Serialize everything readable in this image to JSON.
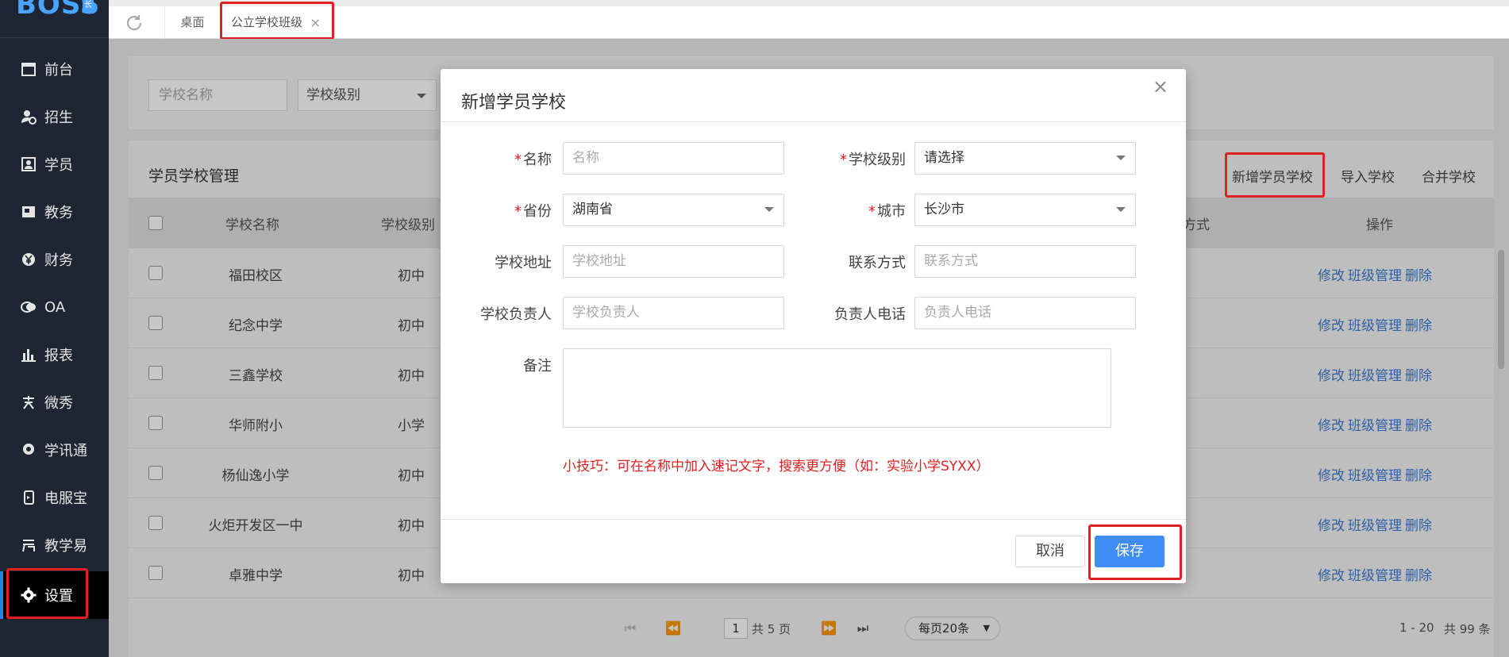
{
  "app": {
    "logo_text": "BOSS",
    "logo_badge": "长"
  },
  "sidebar": {
    "items": [
      {
        "label": "前台",
        "icon": "calendar-icon"
      },
      {
        "label": "招生",
        "icon": "user-add-icon"
      },
      {
        "label": "学员",
        "icon": "person-card-icon"
      },
      {
        "label": "教务",
        "icon": "book-icon"
      },
      {
        "label": "财务",
        "icon": "yen-icon"
      },
      {
        "label": "OA",
        "icon": "chat-icon"
      },
      {
        "label": "报表",
        "icon": "bar-chart-icon"
      },
      {
        "label": "微秀",
        "icon": "xiu-icon"
      },
      {
        "label": "学讯通",
        "icon": "location-icon"
      },
      {
        "label": "电服宝",
        "icon": "phone-icon"
      },
      {
        "label": "教学易",
        "icon": "teach-icon"
      },
      {
        "label": "设置",
        "icon": "gear-icon",
        "active": true
      }
    ]
  },
  "tabs": {
    "home": "桌面",
    "current": "公立学校班级",
    "close": "×"
  },
  "filters": {
    "school_name_placeholder": "学校名称",
    "school_level": "学校级别"
  },
  "card": {
    "title": "学员学校管理",
    "actions": {
      "add": "新增学员学校",
      "import": "导入学校",
      "merge": "合并学校"
    }
  },
  "table": {
    "headers": {
      "name": "学校名称",
      "level": "学校级别",
      "contact": "方式",
      "ops": "操作"
    },
    "rows": [
      {
        "name": "福田校区",
        "level": "初中"
      },
      {
        "name": "纪念中学",
        "level": "初中"
      },
      {
        "name": "三鑫学校",
        "level": "初中"
      },
      {
        "name": "华师附小",
        "level": "小学"
      },
      {
        "name": "杨仙逸小学",
        "level": "初中"
      },
      {
        "name": "火炬开发区一中",
        "level": "初中"
      },
      {
        "name": "卓雅中学",
        "level": "初中"
      }
    ],
    "ops": {
      "edit": "修改",
      "class": "班级管理",
      "delete": "删除"
    }
  },
  "pager": {
    "page": "1",
    "total_pages": "共 5 页",
    "page_size": "每页20条",
    "range": "1 - 20",
    "total": "共 99 条"
  },
  "modal": {
    "title": "新增学员学校",
    "close": "×",
    "fields": {
      "name": {
        "label": "名称",
        "placeholder": "名称",
        "required": "*"
      },
      "level": {
        "label": "学校级别",
        "value": "请选择",
        "required": "*"
      },
      "province": {
        "label": "省份",
        "value": "湖南省",
        "required": "*"
      },
      "city": {
        "label": "城市",
        "value": "长沙市",
        "required": "*"
      },
      "address": {
        "label": "学校地址",
        "placeholder": "学校地址"
      },
      "contact": {
        "label": "联系方式",
        "placeholder": "联系方式"
      },
      "principal": {
        "label": "学校负责人",
        "placeholder": "学校负责人"
      },
      "phone": {
        "label": "负责人电话",
        "placeholder": "负责人电话"
      },
      "remark": {
        "label": "备注"
      }
    },
    "tip": "小技巧：可在名称中加入速记文字，搜索更方便（如：实验小学SYXX）",
    "cancel": "取消",
    "save": "保存"
  },
  "colors": {
    "accent": "#3f8cf4",
    "highlight": "#e02020",
    "sidebar": "#1e2634"
  }
}
